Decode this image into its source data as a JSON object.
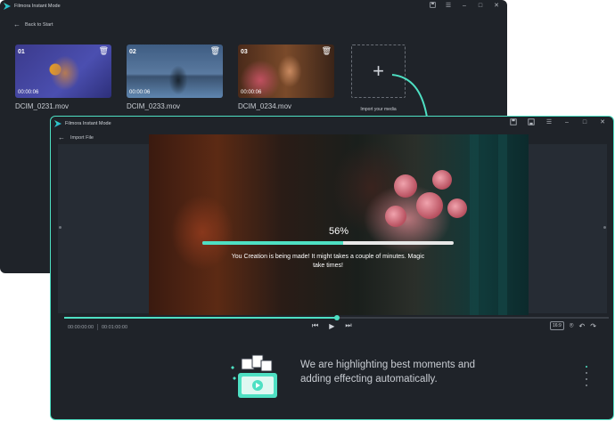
{
  "back_window": {
    "title": "Filmora Instant Mode",
    "back_label": "Back to Start",
    "media": [
      {
        "number": "01",
        "duration": "00:00:06",
        "filename": "DCIM_0231.mov"
      },
      {
        "number": "02",
        "duration": "00:00:06",
        "filename": "DCIM_0233.mov"
      },
      {
        "number": "03",
        "duration": "00:00:06",
        "filename": "DCIM_0234.mov"
      }
    ],
    "import_label": "Import your media"
  },
  "front_window": {
    "title": "Filmora Instant Mode",
    "import_file_label": "Import File",
    "progress": {
      "value": 0.56,
      "text": "56%"
    },
    "message": "You Creation is being made! It might takes a couple of minutes. Magic take times!",
    "timeline_progress": 0.5,
    "time_current": "00:00:00:00",
    "time_total": "00:01:00:00",
    "aspect_ratio": "16:9",
    "bottom_message": "We are highlighting best moments and adding effecting automatically."
  },
  "colors": {
    "accent": "#4ee0c3",
    "window_bg": "#1f2329"
  },
  "icons": [
    "save-icon",
    "list-icon",
    "minimize-icon",
    "maximize-icon",
    "close-icon",
    "arrow-left-icon",
    "trash-icon",
    "plus-icon",
    "skip-back-icon",
    "play-icon",
    "skip-forward-icon",
    "snapshot-icon",
    "undo-icon",
    "redo-icon"
  ]
}
